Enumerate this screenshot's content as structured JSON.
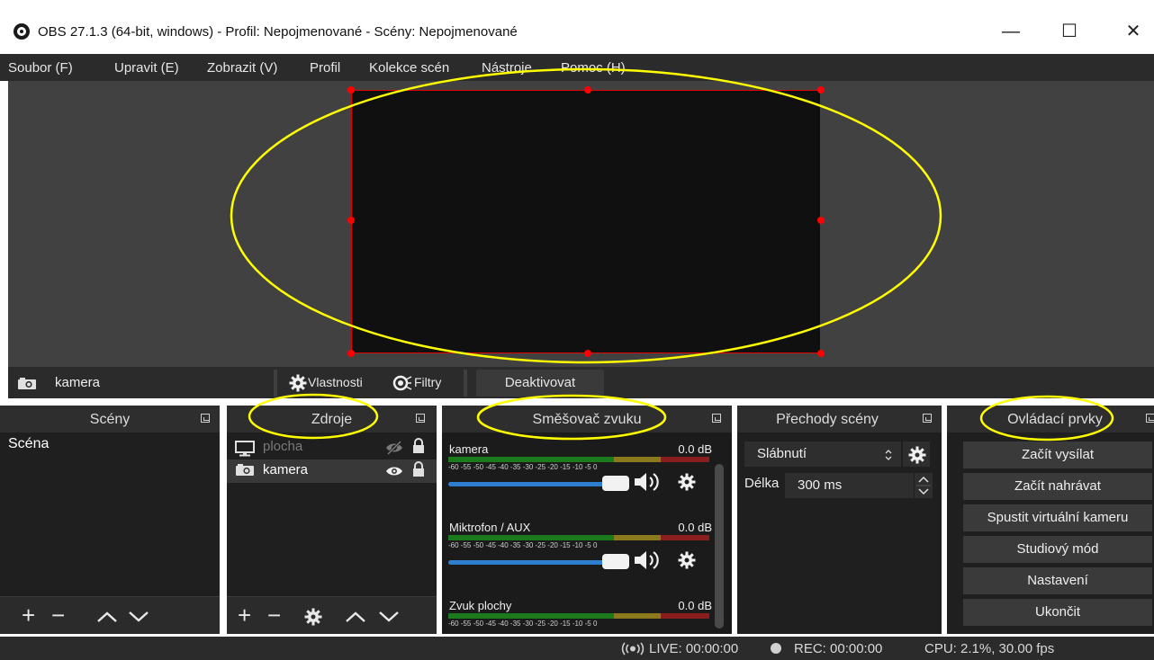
{
  "window": {
    "title": "OBS 27.1.3 (64-bit, windows) - Profil: Nepojmenované - Scény: Nepojmenované",
    "minimize_glyph": "—",
    "maximize_glyph": "☐",
    "close_glyph": "✕"
  },
  "menu": [
    "Soubor (F)",
    "Upravit (E)",
    "Zobrazit (V)",
    "Profil",
    "Kolekce scén",
    "Nástroje",
    "Pomoc (H)"
  ],
  "source_toolbar": {
    "selected_source": "kamera",
    "properties_label": "Vlastnosti",
    "filters_label": "Filtry",
    "deactivate_label": "Deaktivovat"
  },
  "scenes": {
    "title": "Scény",
    "items": [
      "Scéna"
    ]
  },
  "sources": {
    "title": "Zdroje",
    "items": [
      {
        "name": "plocha",
        "type": "display",
        "visible": false,
        "locked": true
      },
      {
        "name": "kamera",
        "type": "camera",
        "visible": true,
        "locked": true
      }
    ]
  },
  "mixer": {
    "title": "Směšovač zvuku",
    "channels": [
      {
        "name": "kamera",
        "level": "0.0 dB",
        "volume": 1.0
      },
      {
        "name": "Miktrofon / AUX",
        "level": "0.0 dB",
        "volume": 1.0
      },
      {
        "name": "Zvuk plochy",
        "level": "0.0 dB",
        "volume": 1.0
      }
    ],
    "scale": "-60  -55  -50  -45  -40  -35  -30  -25  -20  -15  -10   -5    0"
  },
  "transitions": {
    "title": "Přechody scény",
    "selected": "Slábnutí",
    "duration_label": "Délka",
    "duration_value": "300 ms"
  },
  "controls": {
    "title": "Ovládací prvky",
    "buttons": [
      "Začít vysílat",
      "Začít nahrávat",
      "Spustit virtuální kameru",
      "Studiový mód",
      "Nastavení",
      "Ukončit"
    ]
  },
  "status": {
    "live": "LIVE: 00:00:00",
    "rec": "REC: 00:00:00",
    "cpu": "CPU: 2.1%, 30.00 fps"
  },
  "colors": {
    "annotation": "#ffff00",
    "selection": "#ff0000",
    "volume_slider": "#2f7fd1"
  }
}
